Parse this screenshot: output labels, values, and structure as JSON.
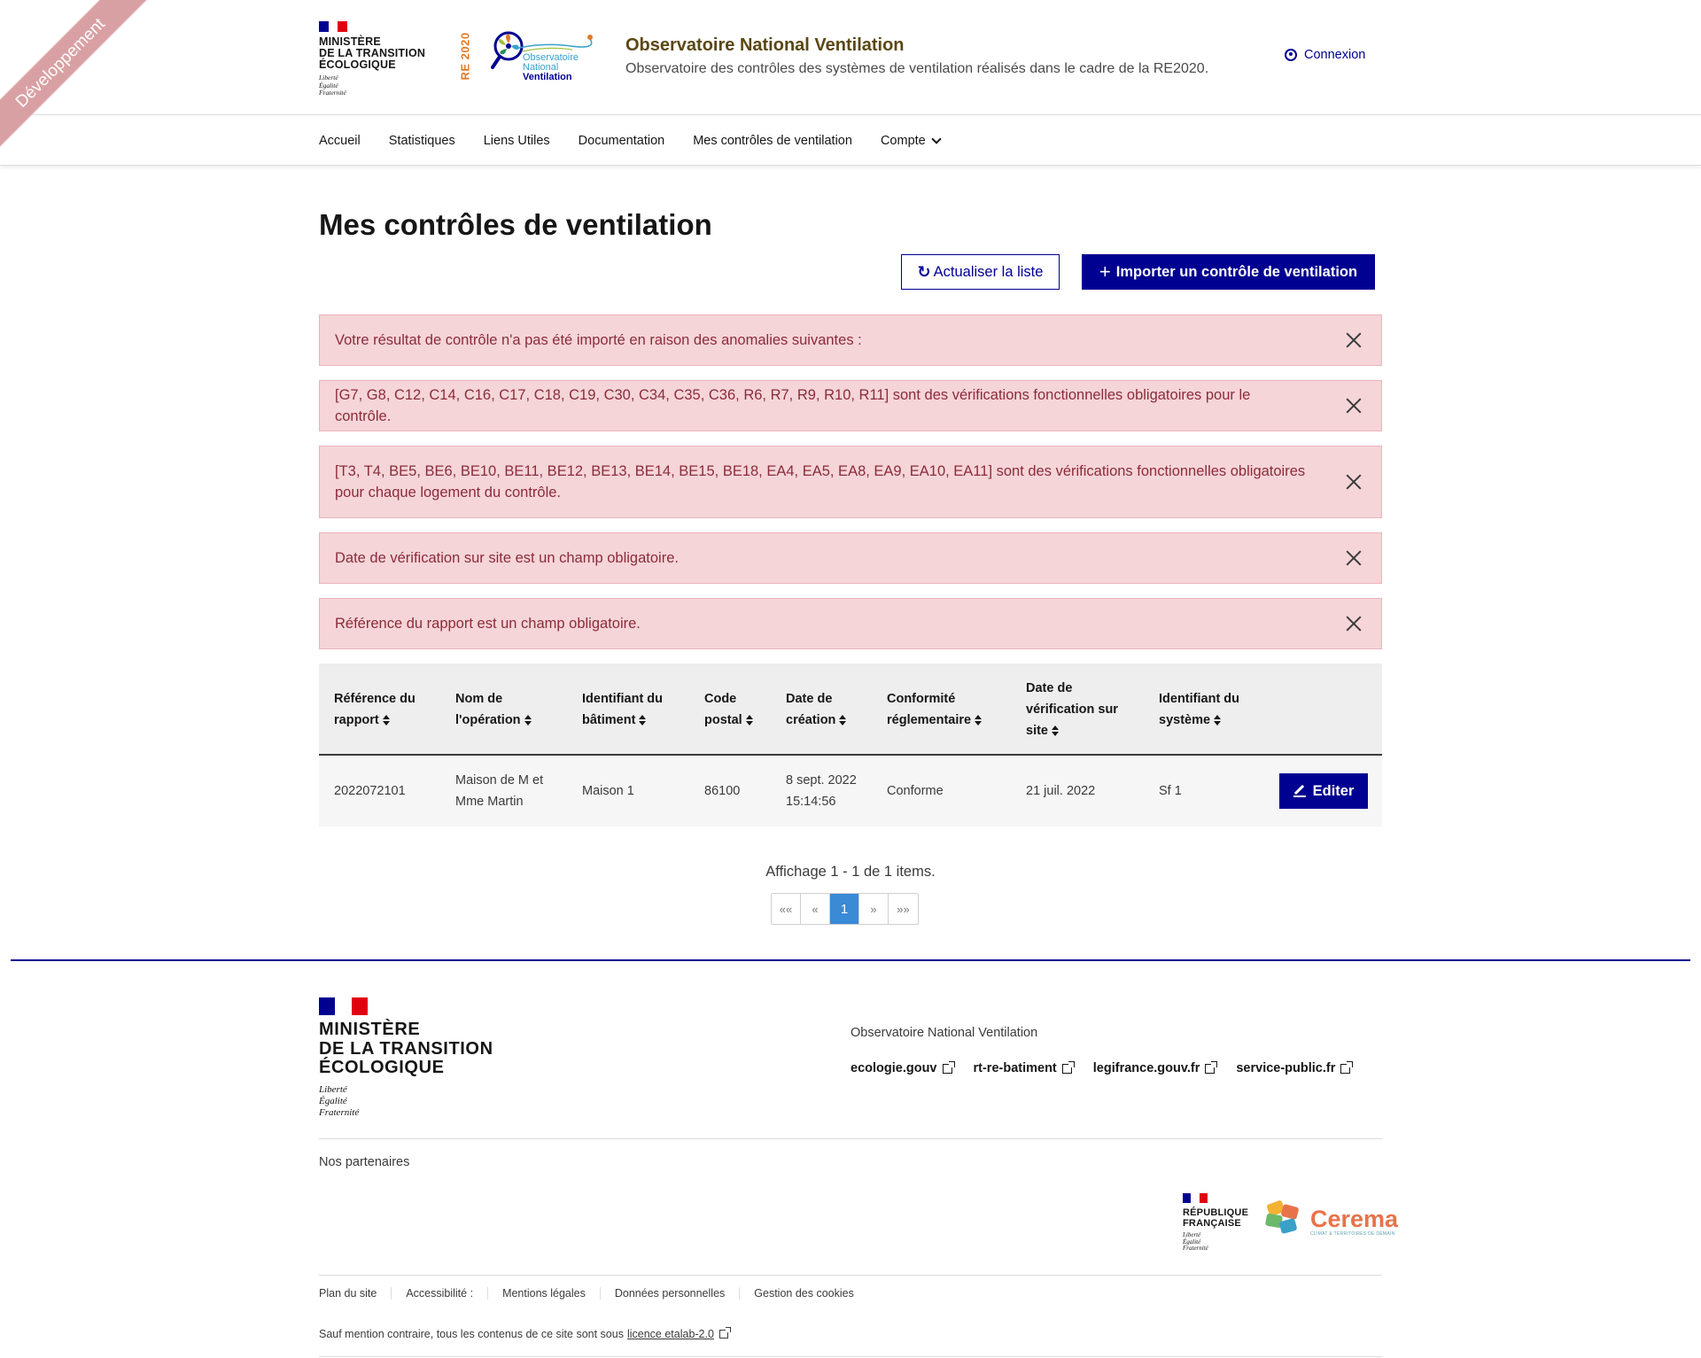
{
  "ribbon": "Développement",
  "header": {
    "ministry_lines": [
      "MINISTÈRE",
      "DE LA TRANSITION",
      "ÉCOLOGIQUE"
    ],
    "motto_lines": [
      "Liberté",
      "Égalité",
      "Fraternité"
    ],
    "logo_re": "RE 2020",
    "logo_lines": [
      "Observatoire",
      "National",
      "Ventilation"
    ],
    "site_title": "Observatoire National Ventilation",
    "site_tagline": "Observatoire des contrôles des systèmes de ventilation réalisés dans le cadre de la RE2020.",
    "login_label": "Connexion"
  },
  "nav": {
    "items": [
      "Accueil",
      "Statistiques",
      "Liens Utiles",
      "Documentation",
      "Mes contrôles de ventilation",
      "Compte"
    ]
  },
  "main": {
    "title": "Mes contrôles de ventilation",
    "refresh_icon": "↻",
    "refresh_label": "Actualiser la liste",
    "import_icon": "+",
    "import_label": "Importer un contrôle de ventilation",
    "alerts": [
      "Votre résultat de contrôle n'a pas été importé en raison des anomalies suivantes :",
      "[G7, G8, C12, C14, C16, C17, C18, C19, C30, C34, C35, C36, R6, R7, R9, R10, R11] sont des vérifications fonctionnelles obligatoires pour le contrôle.",
      "[T3, T4, BE5, BE6, BE10, BE11, BE12, BE13, BE14, BE15, BE18, EA4, EA5, EA8, EA9, EA10, EA11] sont des vérifications fonctionnelles obligatoires pour chaque logement du contrôle.",
      "Date de vérification sur site est un champ obligatoire.",
      "Référence du rapport est un champ obligatoire."
    ]
  },
  "table": {
    "headers": [
      [
        "Référence du",
        "rapport"
      ],
      [
        "Nom de",
        "l'opération"
      ],
      [
        "Identifiant du",
        "bâtiment"
      ],
      [
        "Code",
        "postal"
      ],
      [
        "Date de",
        "création"
      ],
      [
        "Conformité",
        "réglementaire"
      ],
      [
        "Date de",
        "vérification sur",
        "site"
      ],
      [
        "Identifiant du",
        "système"
      ]
    ],
    "rows": [
      {
        "reference": "2022072101",
        "operation": [
          "Maison de M et",
          "Mme Martin"
        ],
        "batiment": "Maison 1",
        "code_postal": "86100",
        "date_creation": [
          "8 sept. 2022",
          "15:14:56"
        ],
        "conformite": "Conforme",
        "date_verification": "21 juil. 2022",
        "systeme": "Sf 1",
        "edit_label": "Editer"
      }
    ]
  },
  "pagination": {
    "info": "Affichage 1 - 1 de 1 items.",
    "first": "««",
    "prev": "«",
    "current": "1",
    "next": "»",
    "last": "»»"
  },
  "footer": {
    "ministry_lines": [
      "MINISTÈRE",
      "DE LA TRANSITION",
      "ÉCOLOGIQUE"
    ],
    "motto_lines": [
      "Liberté",
      "Égalité",
      "Fraternité"
    ],
    "site_name": "Observatoire National Ventilation",
    "links": [
      "ecologie.gouv",
      "rt-re-batiment",
      "legifrance.gouv.fr",
      "service-public.fr"
    ],
    "partners_title": "Nos partenaires",
    "rf_lines": [
      "RÉPUBLIQUE",
      "FRANÇAISE"
    ],
    "rf_motto": [
      "Liberté",
      "Égalité",
      "Fraternité"
    ],
    "cerema_name": "Cerema",
    "cerema_sub": "CLIMAT & TERRITOIRES DE DEMAIN",
    "bottom_links": [
      "Plan du site",
      "Accessibilité :",
      "Mentions légales",
      "Données personnelles",
      "Gestion des cookies"
    ],
    "licence_prefix": "Sauf mention contraire, tous les contenus de ce site sont sous",
    "licence_link": "licence etalab-2.0"
  },
  "colors": {
    "primary": "#000091",
    "alert_bg": "#f5d5d8",
    "alert_text": "#8c2b3b",
    "ribbon": "#d9a0a3",
    "pagination_active": "#3a8ad6",
    "title_brown": "#5a4712"
  },
  "icons": {
    "login": "user-circle-icon",
    "refresh": "refresh-icon",
    "import": "plus-icon",
    "close": "close-icon",
    "sort": "sort-icon",
    "edit": "pencil-icon",
    "external": "external-link-icon"
  }
}
